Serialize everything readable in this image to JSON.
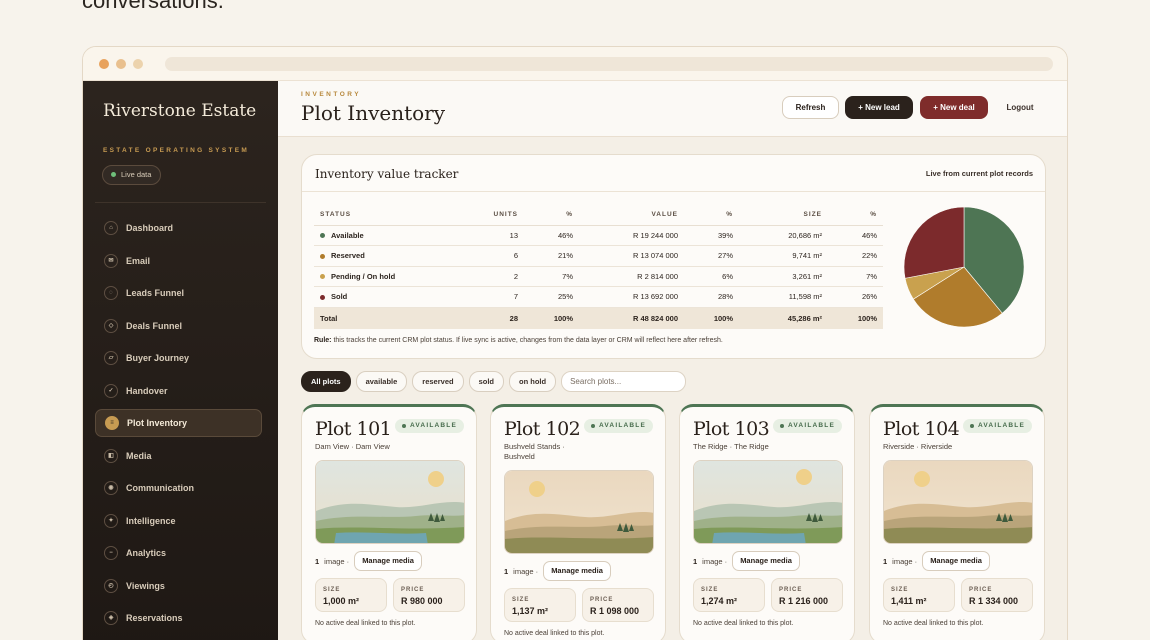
{
  "top_text": "conversations.",
  "colors": {
    "accent_gold": "#c79b52",
    "brand_dark": "#2b221c",
    "deal_red": "#7f2c2b",
    "available_green": "#4e7554"
  },
  "sidebar": {
    "brand": "Riverstone Estate",
    "subtitle": "ESTATE OPERATING SYSTEM",
    "live_label": "Live data",
    "items": [
      {
        "label": "Dashboard",
        "icon": "home-icon",
        "glyph": "⌂"
      },
      {
        "label": "Email",
        "icon": "mail-icon",
        "glyph": "✉"
      },
      {
        "label": "Leads Funnel",
        "icon": "funnel-icon",
        "glyph": "◌"
      },
      {
        "label": "Deals Funnel",
        "icon": "deals-icon",
        "glyph": "◇"
      },
      {
        "label": "Buyer Journey",
        "icon": "journey-icon",
        "glyph": "▱"
      },
      {
        "label": "Handover",
        "icon": "check-icon",
        "glyph": "✓"
      },
      {
        "label": "Plot Inventory",
        "icon": "inventory-icon",
        "glyph": "≡"
      },
      {
        "label": "Media",
        "icon": "media-icon",
        "glyph": "◧"
      },
      {
        "label": "Communication",
        "icon": "communication-icon",
        "glyph": "◉"
      },
      {
        "label": "Intelligence",
        "icon": "intelligence-icon",
        "glyph": "✦"
      },
      {
        "label": "Analytics",
        "icon": "analytics-icon",
        "glyph": "−"
      },
      {
        "label": "Viewings",
        "icon": "viewings-icon",
        "glyph": "◴"
      },
      {
        "label": "Reservations",
        "icon": "reservations-icon",
        "glyph": "◈"
      }
    ]
  },
  "header": {
    "eyebrow": "INVENTORY",
    "title": "Plot Inventory",
    "refresh": "Refresh",
    "new_lead": "+ New lead",
    "new_deal": "+ New deal",
    "logout": "Logout"
  },
  "tracker": {
    "title": "Inventory value tracker",
    "live": "Live from current plot records",
    "columns": [
      "STATUS",
      "UNITS",
      "%",
      "VALUE",
      "%",
      "SIZE",
      "%"
    ],
    "rows": [
      {
        "status": "Available",
        "units": "13",
        "units_pct": "46%",
        "value": "R 19 244 000",
        "value_pct": "39%",
        "size": "20,686 m²",
        "size_pct": "46%",
        "color": "#4e7554"
      },
      {
        "status": "Reserved",
        "units": "6",
        "units_pct": "21%",
        "value": "R 13 074 000",
        "value_pct": "27%",
        "size": "9,741 m²",
        "size_pct": "22%",
        "color": "#b07c2c"
      },
      {
        "status": "Pending / On hold",
        "units": "2",
        "units_pct": "7%",
        "value": "R 2 814 000",
        "value_pct": "6%",
        "size": "3,261 m²",
        "size_pct": "7%",
        "color": "#c9a14e"
      },
      {
        "status": "Sold",
        "units": "7",
        "units_pct": "25%",
        "value": "R 13 692 000",
        "value_pct": "28%",
        "size": "11,598 m²",
        "size_pct": "26%",
        "color": "#7c2a2c"
      }
    ],
    "total": {
      "status": "Total",
      "units": "28",
      "units_pct": "100%",
      "value": "R 48 824 000",
      "value_pct": "100%",
      "size": "45,286 m²",
      "size_pct": "100%"
    },
    "rule_label": "Rule:",
    "rule_text": " this tracks the current CRM plot status. If live sync is active, changes from the data layer or CRM will reflect here after refresh.",
    "pie": [
      {
        "label": "Available",
        "value": 39,
        "color": "#4e7554"
      },
      {
        "label": "Reserved",
        "value": 27,
        "color": "#b07c2c"
      },
      {
        "label": "Pending / On hold",
        "value": 6,
        "color": "#c9a14e"
      },
      {
        "label": "Sold",
        "value": 28,
        "color": "#7c2a2c"
      }
    ]
  },
  "filters": {
    "chips": [
      "All plots",
      "available",
      "reserved",
      "sold",
      "on hold"
    ],
    "search_placeholder": "Search plots..."
  },
  "plots": [
    {
      "title": "Plot 101",
      "status": "AVAILABLE",
      "location": "Dam View · Dam View",
      "images": "1",
      "image_label": "image ·",
      "manage": "Manage media",
      "size_label": "SIZE",
      "size": "1,000 m²",
      "price_label": "PRICE",
      "price": "R 980 000",
      "deal": "No active deal linked to this plot."
    },
    {
      "title": "Plot 102",
      "status": "AVAILABLE",
      "location": "Bushveld Stands · Bushveld",
      "images": "1",
      "image_label": "image ·",
      "manage": "Manage media",
      "size_label": "SIZE",
      "size": "1,137 m²",
      "price_label": "PRICE",
      "price": "R 1 098 000",
      "deal": "No active deal linked to this plot."
    },
    {
      "title": "Plot 103",
      "status": "AVAILABLE",
      "location": "The Ridge · The Ridge",
      "images": "1",
      "image_label": "image ·",
      "manage": "Manage media",
      "size_label": "SIZE",
      "size": "1,274 m²",
      "price_label": "PRICE",
      "price": "R 1 216 000",
      "deal": "No active deal linked to this plot."
    },
    {
      "title": "Plot 104",
      "status": "AVAILABLE",
      "location": "Riverside · Riverside",
      "images": "1",
      "image_label": "image ·",
      "manage": "Manage media",
      "size_label": "SIZE",
      "size": "1,411 m²",
      "price_label": "PRICE",
      "price": "R 1 334 000",
      "deal": "No active deal linked to this plot."
    }
  ]
}
